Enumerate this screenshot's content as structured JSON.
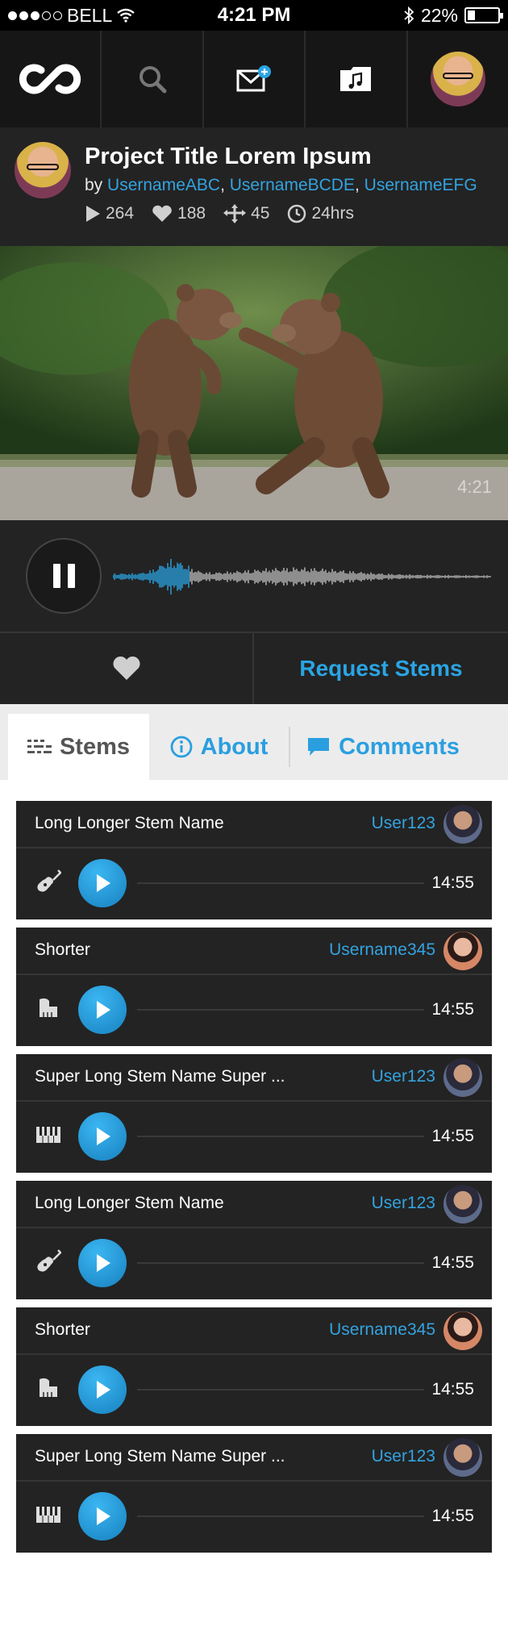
{
  "status_bar": {
    "carrier": "BELL",
    "time": "4:21 PM",
    "battery": "22%",
    "battery_level": 0.22,
    "signal_bars_filled": 3,
    "signal_bars_total": 5,
    "icons": [
      "wifi-icon",
      "bluetooth-icon",
      "battery-icon"
    ]
  },
  "nav": {
    "items": [
      "logo-icon",
      "search-icon",
      "messages-icon",
      "music-folder-icon",
      "profile-avatar"
    ]
  },
  "project": {
    "title": "Project Title Lorem Ipsum",
    "by_prefix": "by",
    "collaborators": [
      "UsernameABC",
      "UsernameBCDE",
      "UsernameEFG"
    ],
    "separator": ", ",
    "stats": {
      "plays": "264",
      "likes": "188",
      "forks": "45",
      "age": "24hrs"
    }
  },
  "media": {
    "duration_overlay": "4:21"
  },
  "player": {
    "state": "playing",
    "progress": 0.2
  },
  "actions": {
    "request_stems_label": "Request Stems"
  },
  "tabs": [
    {
      "label": "Stems",
      "icon": "stems-icon",
      "active": true
    },
    {
      "label": "About",
      "icon": "info-icon",
      "active": false
    },
    {
      "label": "Comments",
      "icon": "comment-icon",
      "active": false
    }
  ],
  "stems": [
    {
      "name": "Long Longer Stem Name",
      "user": "User123",
      "instrument": "guitar-icon",
      "duration": "14:55"
    },
    {
      "name": "Shorter",
      "user": "Username345",
      "instrument": "piano-icon",
      "duration": "14:55"
    },
    {
      "name": "Super Long Stem Name Super ...",
      "user": "User123",
      "instrument": "keyboard-icon",
      "duration": "14:55"
    },
    {
      "name": "Long Longer Stem Name",
      "user": "User123",
      "instrument": "guitar-icon",
      "duration": "14:55"
    },
    {
      "name": "Shorter",
      "user": "Username345",
      "instrument": "piano-icon",
      "duration": "14:55"
    },
    {
      "name": "Super Long Stem Name Super ...",
      "user": "User123",
      "instrument": "keyboard-icon",
      "duration": "14:55"
    }
  ],
  "colors": {
    "accent": "#2aa5e4",
    "dark_panel": "#232323",
    "nav_bg": "#161616"
  }
}
